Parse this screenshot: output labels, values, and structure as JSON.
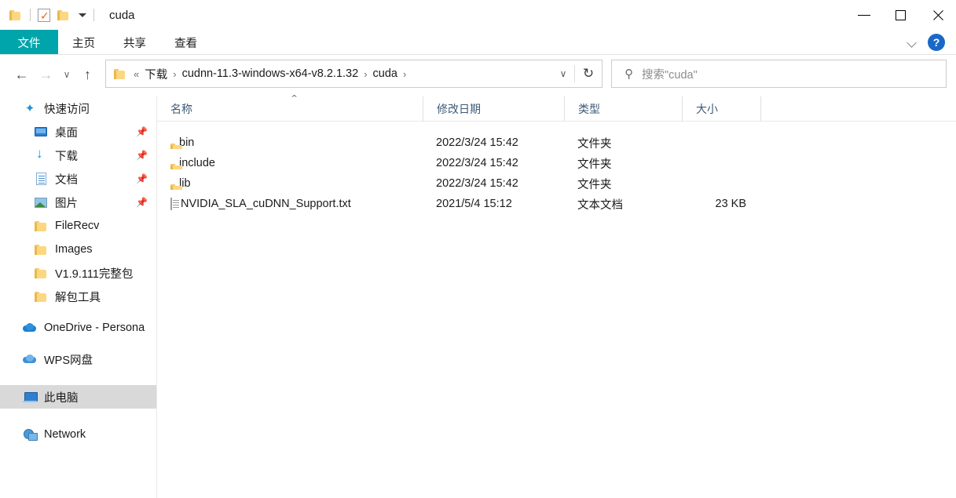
{
  "window": {
    "title": "cuda",
    "quick_access_toolbar": [
      {
        "name": "folder-icon",
        "label": "folder"
      },
      {
        "name": "properties-icon",
        "label": "properties"
      },
      {
        "name": "new-folder-icon",
        "label": "new folder"
      },
      {
        "name": "customize-caret-icon",
        "label": "customize quick access toolbar"
      }
    ],
    "controls": {
      "minimize": "—",
      "maximize": "□",
      "close": "✕"
    }
  },
  "ribbon": {
    "tabs": [
      {
        "label": "文件",
        "active": true
      },
      {
        "label": "主页",
        "active": false
      },
      {
        "label": "共享",
        "active": false
      },
      {
        "label": "查看",
        "active": false
      }
    ],
    "expand_label": "∨",
    "help_label": "?",
    "accent_color": "#00a5ab"
  },
  "navbar": {
    "back_label": "←",
    "forward_label": "→",
    "recent_label": "∨",
    "up_label": "↑",
    "breadcrumb": {
      "overflow": "«",
      "parts": [
        "下载",
        "cudnn-11.3-windows-x64-v8.2.1.32",
        "cuda"
      ],
      "separator": "›",
      "dropdown_label": "∨"
    },
    "refresh_label": "↻"
  },
  "search": {
    "placeholder": "搜索\"cuda\"",
    "icon": "search-icon"
  },
  "sidebar": {
    "items": [
      {
        "label": "快速访问",
        "icon": "star-icon",
        "level": "root",
        "pinned": false,
        "selected": false
      },
      {
        "label": "桌面",
        "icon": "desktop-icon",
        "level": "child",
        "pinned": true,
        "selected": false
      },
      {
        "label": "下载",
        "icon": "download-icon",
        "level": "child",
        "pinned": true,
        "selected": false
      },
      {
        "label": "文档",
        "icon": "document-icon",
        "level": "child",
        "pinned": true,
        "selected": false
      },
      {
        "label": "图片",
        "icon": "pictures-icon",
        "level": "child",
        "pinned": true,
        "selected": false
      },
      {
        "label": "FileRecv",
        "icon": "folder-icon",
        "level": "child",
        "pinned": false,
        "selected": false
      },
      {
        "label": "Images",
        "icon": "folder-icon",
        "level": "child",
        "pinned": false,
        "selected": false
      },
      {
        "label": "V1.9.111完整包",
        "icon": "folder-icon",
        "level": "child",
        "pinned": false,
        "selected": false
      },
      {
        "label": "解包工具",
        "icon": "folder-icon",
        "level": "child",
        "pinned": false,
        "selected": false
      },
      {
        "label": "OneDrive - Persona",
        "icon": "onedrive-cloud-icon",
        "level": "root",
        "pinned": false,
        "selected": false
      },
      {
        "label": "WPS网盘",
        "icon": "wps-cloud-icon",
        "level": "root",
        "pinned": false,
        "selected": false
      },
      {
        "label": "此电脑",
        "icon": "this-pc-icon",
        "level": "root",
        "pinned": false,
        "selected": true
      },
      {
        "label": "Network",
        "icon": "network-icon",
        "level": "root",
        "pinned": false,
        "selected": false
      }
    ],
    "pin_glyph": "📌",
    "selected_bg": "#d9d9d9"
  },
  "file_list": {
    "columns": [
      {
        "label": "名称",
        "sorted": "asc",
        "sort_glyph": "⌃"
      },
      {
        "label": "修改日期",
        "sorted": null
      },
      {
        "label": "类型",
        "sorted": null
      },
      {
        "label": "大小",
        "sorted": null
      }
    ],
    "rows": [
      {
        "name": "bin",
        "icon": "folder-icon",
        "date": "2022/3/24 15:42",
        "type": "文件夹",
        "size": ""
      },
      {
        "name": "include",
        "icon": "folder-icon",
        "date": "2022/3/24 15:42",
        "type": "文件夹",
        "size": ""
      },
      {
        "name": "lib",
        "icon": "folder-icon",
        "date": "2022/3/24 15:42",
        "type": "文件夹",
        "size": ""
      },
      {
        "name": "NVIDIA_SLA_cuDNN_Support.txt",
        "icon": "text-file-icon",
        "date": "2021/5/4 15:12",
        "type": "文本文档",
        "size": "23 KB"
      }
    ]
  }
}
